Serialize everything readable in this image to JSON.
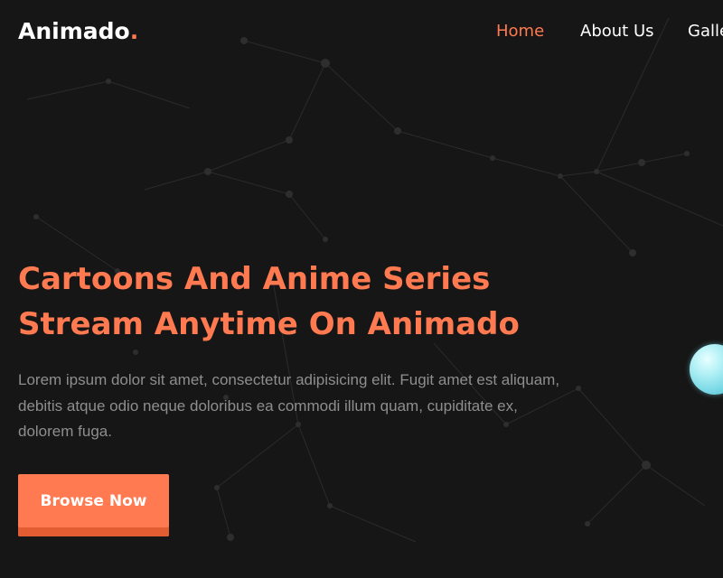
{
  "brand": {
    "name": "Animado",
    "dot": ".",
    "accent_color": "#ff7a50"
  },
  "nav": {
    "items": [
      {
        "label": "Home",
        "active": true
      },
      {
        "label": "About Us",
        "active": false
      },
      {
        "label": "Gallery",
        "active": false
      }
    ]
  },
  "hero": {
    "title_line1": "Cartoons And Anime Series",
    "title_line2": "Stream Anytime On Animado",
    "description": "Lorem ipsum dolor sit amet, consectetur adipisicing elit. Fugit amet est aliquam, debitis atque odio neque doloribus ea commodi illum quam, cupiditate ex, dolorem fuga.",
    "cta_label": "Browse Now"
  },
  "theme": {
    "background": "#161616",
    "text_muted": "#8e8e8e",
    "button_shadow": "#e25d32"
  }
}
